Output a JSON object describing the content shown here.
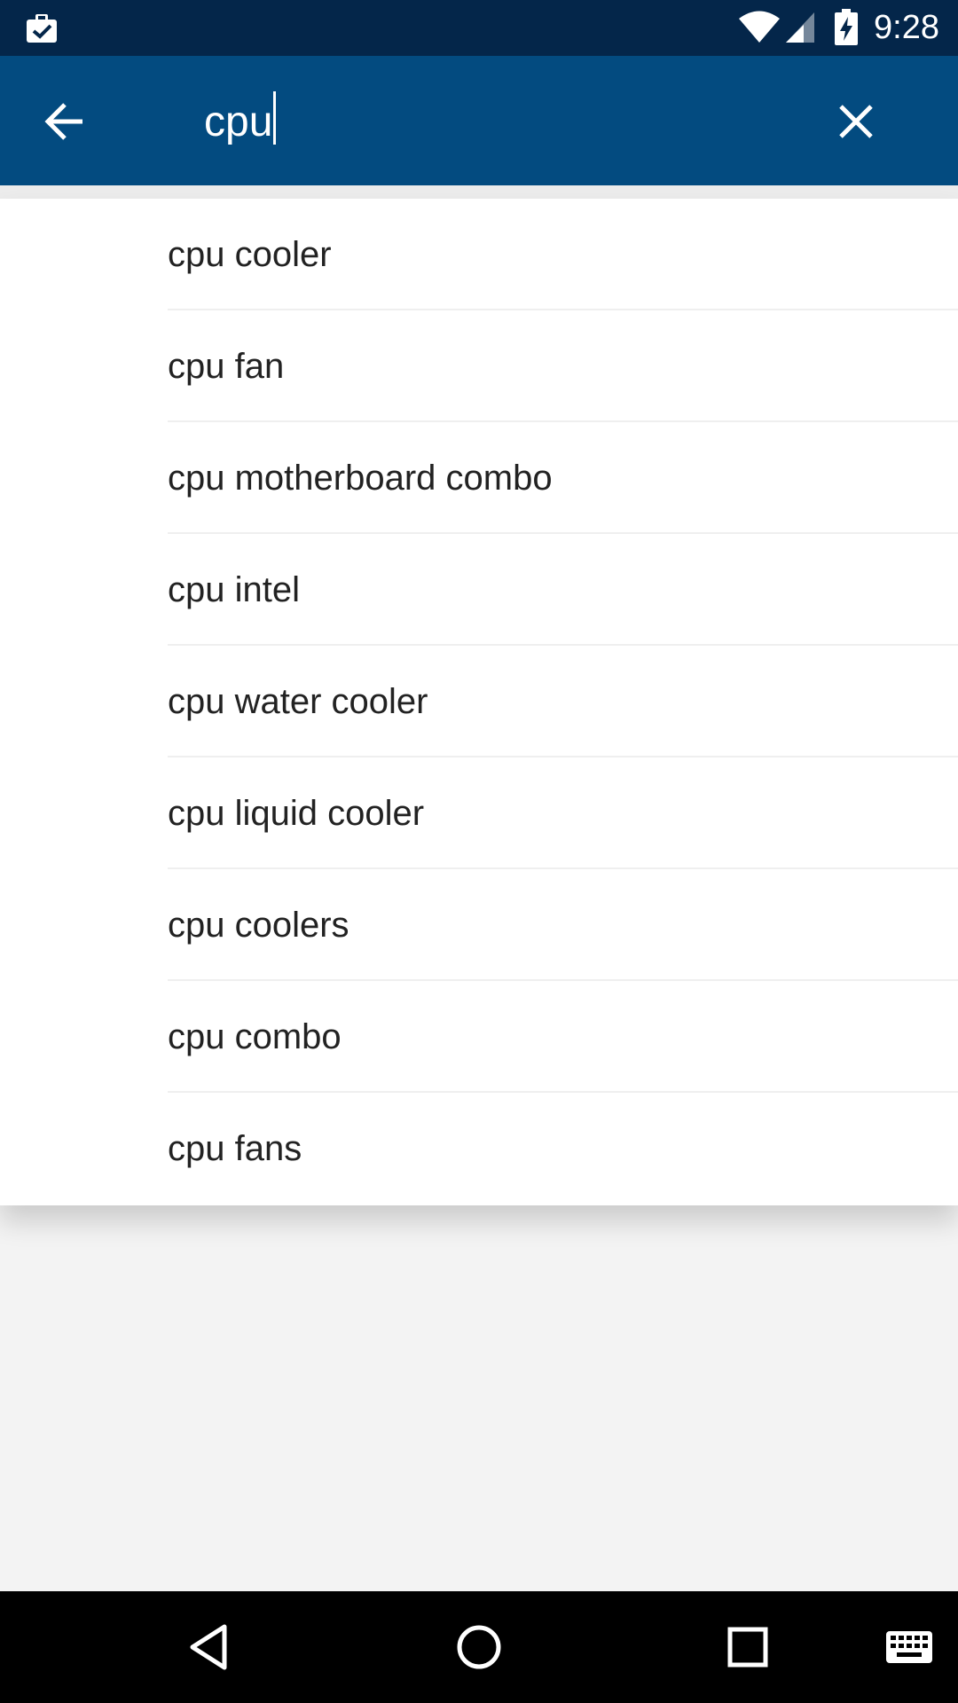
{
  "status_bar": {
    "time": "9:28",
    "icons": [
      "notification-clipboard-icon",
      "wifi-icon",
      "signal-icon",
      "battery-charging-icon"
    ]
  },
  "search": {
    "query": "cpu",
    "icons": {
      "back": "back-arrow-icon",
      "clear": "close-icon"
    }
  },
  "suggestions": [
    {
      "label": "cpu cooler"
    },
    {
      "label": "cpu fan"
    },
    {
      "label": "cpu motherboard combo"
    },
    {
      "label": "cpu intel"
    },
    {
      "label": "cpu water cooler"
    },
    {
      "label": "cpu liquid cooler"
    },
    {
      "label": "cpu coolers"
    },
    {
      "label": "cpu combo"
    },
    {
      "label": "cpu fans"
    }
  ],
  "nav_bar": {
    "icons": [
      "nav-back-icon",
      "nav-home-icon",
      "nav-recents-icon",
      "keyboard-icon"
    ]
  },
  "colors": {
    "status_bar": "#04264a",
    "app_bar": "#034b80",
    "background": "#f3f3f3",
    "text": "#222222"
  }
}
